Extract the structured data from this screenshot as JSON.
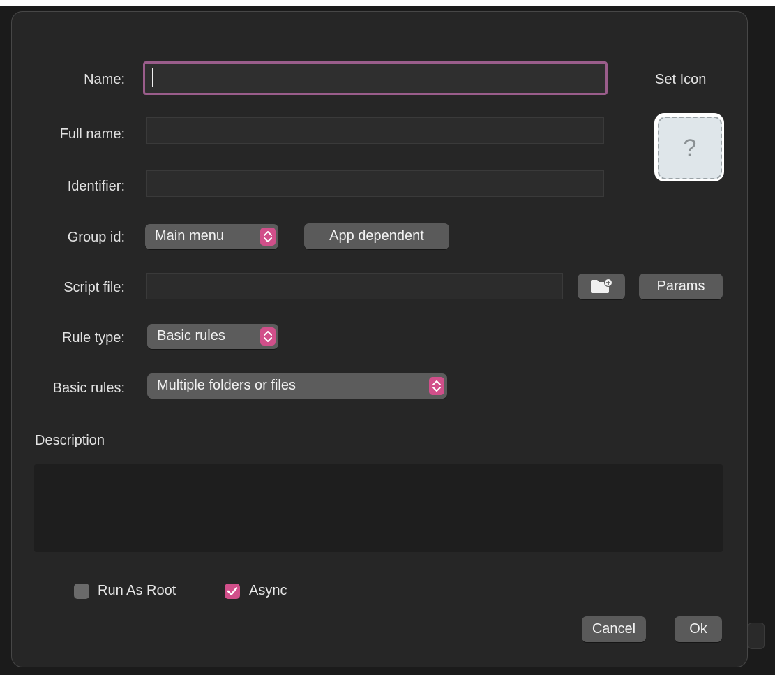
{
  "form": {
    "name_label": "Name:",
    "name_value": "",
    "fullname_label": "Full name:",
    "fullname_value": "",
    "identifier_label": "Identifier:",
    "identifier_value": "",
    "group_label": "Group id:",
    "group_value": "Main menu",
    "app_dependent_label": "App dependent",
    "script_label": "Script file:",
    "script_value": "",
    "params_label": "Params",
    "ruletype_label": "Rule type:",
    "ruletype_value": "Basic rules",
    "basicrules_label": "Basic rules:",
    "basicrules_value": "Multiple folders or files",
    "description_label": "Description",
    "description_value": ""
  },
  "icon": {
    "set_icon_label": "Set Icon",
    "placeholder_glyph": "?"
  },
  "options": {
    "run_as_root_label": "Run As Root",
    "run_as_root_checked": false,
    "async_label": "Async",
    "async_checked": true
  },
  "footer": {
    "cancel_label": "Cancel",
    "ok_label": "Ok"
  },
  "colors": {
    "accent": "#d14f8a",
    "focus_ring": "#9a5d8b",
    "dialog_bg": "#262626"
  }
}
